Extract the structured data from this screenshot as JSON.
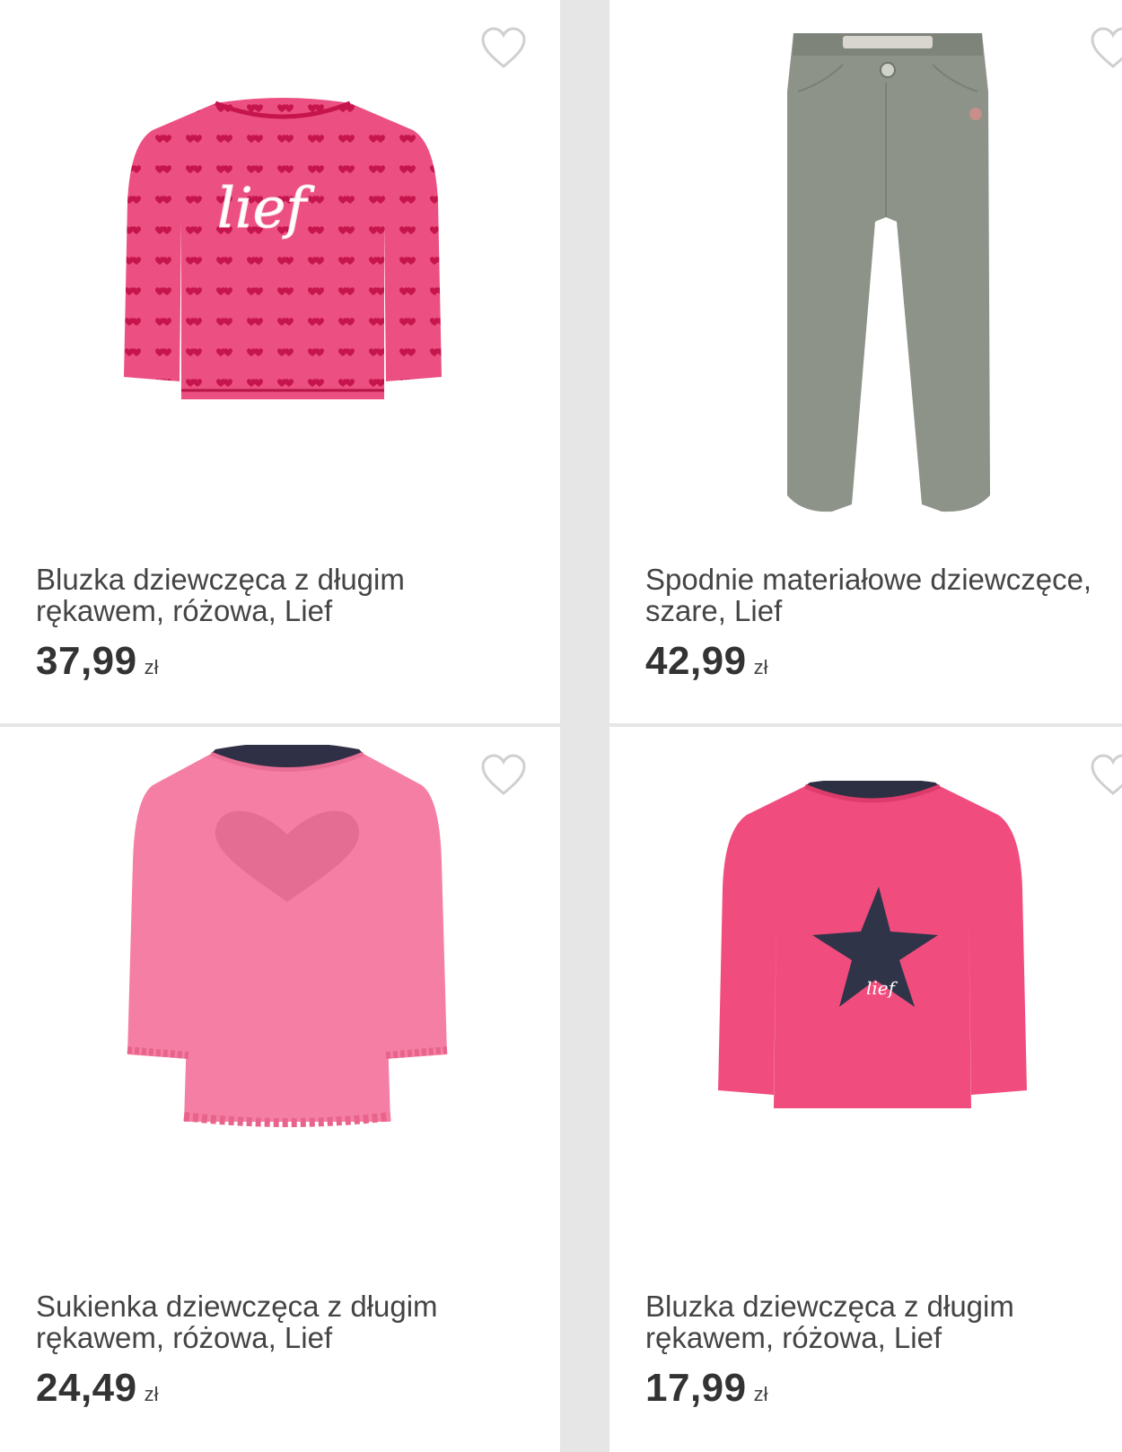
{
  "products": [
    {
      "title": "Bluzka dziewczęca z długim rękawem, różowa, Lief",
      "price": "37,99",
      "currency": "zł",
      "image": "pink-heart-print-long-sleeve-top",
      "color": "#e8457a"
    },
    {
      "title": "Spodnie materiałowe dziewczęce, szare, Lief",
      "price": "42,99",
      "currency": "zł",
      "image": "grey-trousers",
      "color": "#8d9388"
    },
    {
      "title": "Sukienka dziewczęca z długim rękawem, różowa, Lief",
      "price": "24,49",
      "currency": "zł",
      "image": "pink-dress-heart-appliqué",
      "color": "#f57fa4"
    },
    {
      "title": "Bluzka dziewczęca z długim rękawem, różowa, Lief",
      "price": "17,99",
      "currency": "zł",
      "image": "pink-top-navy-star",
      "color": "#f04d7e"
    }
  ],
  "icons": {
    "favorite": "heart-outline-icon"
  }
}
